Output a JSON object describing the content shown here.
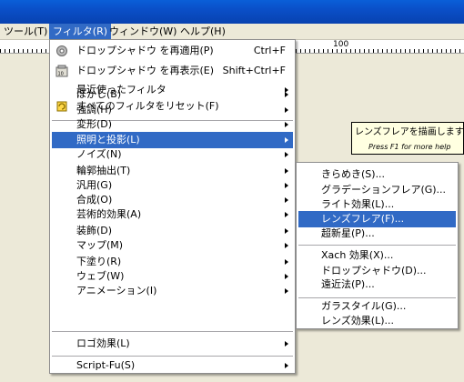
{
  "menubar": [
    "ツール(T)",
    "フィルタ(R)",
    "ウィンドウ(W)",
    "ヘルプ(H)"
  ],
  "ruler": {
    "mark": "100"
  },
  "tooltip": {
    "text": "レンズフレアを描画します",
    "hint": "Press F1 for more help"
  },
  "filters_menu": {
    "top": [
      {
        "label": "ドロップシャドウ を再適用(P)",
        "shortcut": "Ctrl+F",
        "icon": "reapply-filter-icon"
      },
      {
        "label": "ドロップシャドウ を再表示(E)",
        "shortcut": "Shift+Ctrl+F",
        "icon": "reshow-filter-icon"
      },
      {
        "label": "最近使ったフィルタ",
        "submenu": true
      },
      {
        "label": "すべてのフィルタをリセット(F)",
        "icon": "reset-filters-icon"
      }
    ],
    "categories": [
      "ぼかし(B)",
      "強調(H)",
      "変形(D)",
      "照明と投影(L)",
      "ノイズ(N)",
      "輪郭抽出(T)",
      "汎用(G)",
      "合成(O)",
      "芸術的効果(A)",
      "装飾(D)",
      "マップ(M)",
      "下塗り(R)",
      "ウェブ(W)",
      "アニメーション(I)"
    ],
    "highlighted": "照明と投影(L)",
    "bottom": [
      "ロゴ効果(L)",
      "Script-Fu(S)"
    ]
  },
  "light_shadow_submenu": {
    "group1": [
      "きらめき(S)...",
      "グラデーションフレア(G)...",
      "ライト効果(L)...",
      "レンズフレア(F)...",
      "超新星(P)..."
    ],
    "group2": [
      "Xach 効果(X)...",
      "ドロップシャドウ(D)...",
      "遠近法(P)..."
    ],
    "group3": [
      "ガラスタイル(G)...",
      "レンズ効果(L)..."
    ],
    "highlighted": "レンズフレア(F)..."
  },
  "colors": {
    "highlight": "#316ac5",
    "titlebar": "#0a4fc8",
    "tooltip_bg": "#ffffe1"
  }
}
